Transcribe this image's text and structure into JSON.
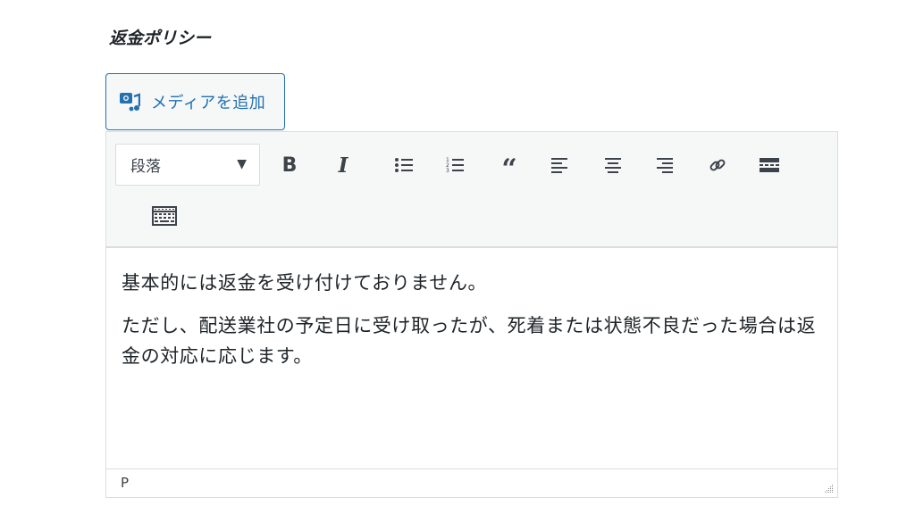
{
  "field": {
    "label": "返金ポリシー"
  },
  "media_button": {
    "label": "メディアを追加",
    "icon": "add-media-icon"
  },
  "toolbar": {
    "format_select": {
      "value": "段落"
    },
    "buttons": [
      {
        "name": "bold",
        "icon": "bold-icon"
      },
      {
        "name": "italic",
        "icon": "italic-icon"
      },
      {
        "name": "bulleted-list",
        "icon": "bulleted-list-icon"
      },
      {
        "name": "numbered-list",
        "icon": "numbered-list-icon"
      },
      {
        "name": "blockquote",
        "icon": "blockquote-icon"
      },
      {
        "name": "align-left",
        "icon": "align-left-icon"
      },
      {
        "name": "align-center",
        "icon": "align-center-icon"
      },
      {
        "name": "align-right",
        "icon": "align-right-icon"
      },
      {
        "name": "insert-link",
        "icon": "link-icon"
      },
      {
        "name": "read-more",
        "icon": "read-more-icon"
      },
      {
        "name": "toolbar-toggle",
        "icon": "keyboard-icon"
      }
    ]
  },
  "content": {
    "paragraphs": [
      "基本的には返金を受け付けておりません。",
      "ただし、配送業社の予定日に受け取ったが、死着または状態不良だった場合は返金の対応に応じます。"
    ]
  },
  "statusbar": {
    "path": "P"
  }
}
